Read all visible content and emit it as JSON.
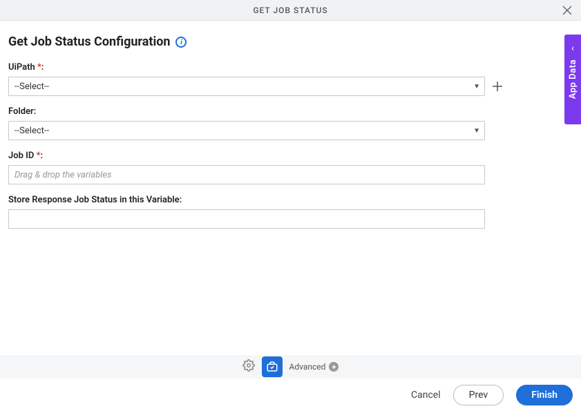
{
  "header": {
    "title": "GET JOB STATUS"
  },
  "page": {
    "title": "Get Job Status Configuration"
  },
  "form": {
    "uipath": {
      "label": "UiPath ",
      "required": "*",
      "colon": ":",
      "value": "--Select--"
    },
    "folder": {
      "label": "Folder:",
      "value": "--Select--"
    },
    "jobid": {
      "label": "Job ID ",
      "required": "*",
      "colon": ":",
      "placeholder": "Drag & drop the variables"
    },
    "store": {
      "label": "Store Response Job Status in this Variable:"
    }
  },
  "sideTab": {
    "label": "App Data"
  },
  "toolbar": {
    "advanced": "Advanced"
  },
  "footer": {
    "cancel": "Cancel",
    "prev": "Prev",
    "finish": "Finish"
  }
}
